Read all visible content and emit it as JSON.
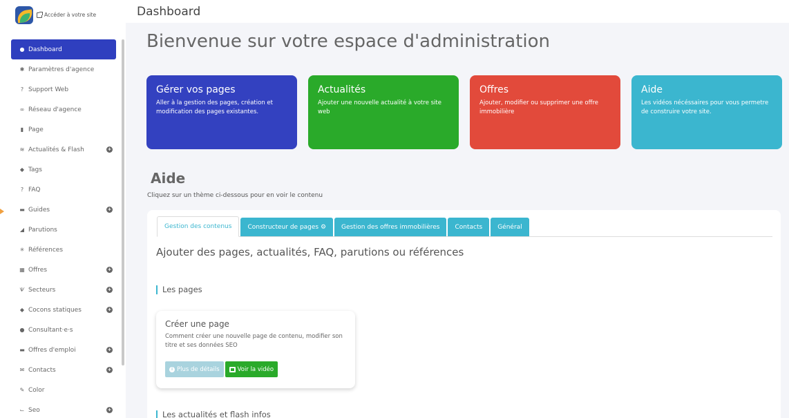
{
  "sidebar": {
    "site_link": "Accéder à votre site",
    "items": [
      {
        "label": "Dashboard",
        "icon": "●"
      },
      {
        "label": "Paramètres d'agence",
        "icon": "✱"
      },
      {
        "label": "Support Web",
        "icon": "?"
      },
      {
        "label": "Réseau d'agence",
        "icon": "∞"
      },
      {
        "label": "Page",
        "icon": "▮"
      },
      {
        "label": "Actualités & Flash",
        "icon": "≋"
      },
      {
        "label": "Tags",
        "icon": "◆"
      },
      {
        "label": "FAQ",
        "icon": "?"
      },
      {
        "label": "Guides",
        "icon": "▬"
      },
      {
        "label": "Parutions",
        "icon": "◢"
      },
      {
        "label": "Références",
        "icon": "✳"
      },
      {
        "label": "Offres",
        "icon": "▦"
      },
      {
        "label": "Secteurs",
        "icon": "Ѱ"
      },
      {
        "label": "Cocons statiques",
        "icon": "◆"
      },
      {
        "label": "Consultant·e·s",
        "icon": "●"
      },
      {
        "label": "Offres d'emploi",
        "icon": "▬"
      },
      {
        "label": "Contacts",
        "icon": "✉"
      },
      {
        "label": "Color",
        "icon": "✎"
      },
      {
        "label": "Seo",
        "icon": "⌙"
      }
    ],
    "plus_sign": "+"
  },
  "header": {
    "title": "Dashboard"
  },
  "main": {
    "welcome": "Bienvenue sur votre espace d'administration",
    "cards": [
      {
        "title": "Gérer vos pages",
        "text": "Aller à la gestion des pages, création et modification des pages existantes."
      },
      {
        "title": "Actualités",
        "text": "Ajouter une nouvelle actualité à votre site web"
      },
      {
        "title": "Offres",
        "text": "Ajouter, modifier ou supprimer une offre immobilière"
      },
      {
        "title": "Aide",
        "text": "Les vidéos nécéssaires pour vous permetre de construire votre site."
      }
    ],
    "help": {
      "title": "Aide",
      "subtitle": "Cliquez sur un thème ci-dessous pour en voir le contenu",
      "tabs": [
        "Gestion des contenus",
        "Constructeur de pages ⚙",
        "Gestion des offres immobilières",
        "Contacts",
        "Général"
      ],
      "heading": "Ajouter des pages, actualités, FAQ, parutions ou références",
      "section_pages": "Les pages",
      "section_news": "Les actualités et flash infos",
      "card": {
        "title": "Créer une page",
        "text": "Comment créer une nouvelle page de contenu, modifier son titre et ses données SEO",
        "details_label": "Plus de détails",
        "video_label": "Voir la vidéo"
      }
    }
  },
  "colors": {
    "primary": "#3341c0",
    "green": "#2aaa2a",
    "red": "#e24a3b",
    "cyan": "#3bb6cf"
  }
}
